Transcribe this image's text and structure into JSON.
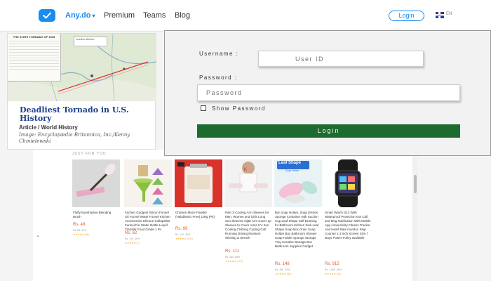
{
  "nav": {
    "brand": "Any.do",
    "links": [
      "Premium",
      "Teams",
      "Blog"
    ],
    "login": "Login",
    "lang": "EN"
  },
  "article": {
    "title": "Deadliest Tornado in U.S. History",
    "subtitle": "Article / World History",
    "credit": "Image: Encyclopædia Britannica, Inc./Kenny Chmielewski",
    "map_table_title": "THE STATE TORNADO OF 1925",
    "map_legend": "counties affected"
  },
  "login": {
    "username_label": "Username :",
    "username_placeholder": "User ID",
    "password_label": "Password :",
    "password_placeholder": "Password",
    "show_password": "Show Password",
    "submit": "Login"
  },
  "products": {
    "section_label": "JUST FOR YOU",
    "items": [
      {
        "name": "Fluffy Eyeshadow Blending Brush",
        "price": "Rs. 49",
        "orig": "Rs. 88 -37%",
        "rating": "★★★★★ (31)"
      },
      {
        "name": "Kitchen Gadgets Silicon Funnel Oil Funnel Water Funnel Kitchen Accessories Silicone Collapsible Funnel For Water Bottle Liquid Transfer Food Grade 1 Pc",
        "price": "Rs. 62",
        "orig": "Rs. 125 -45%",
        "rating": "★★★★★ (7)"
      },
      {
        "name": "Chicken Maze Powder (Halal/MSG Free) 100g (Pk)",
        "price": "Rs. 99",
        "orig": "Rs. 134 -26%",
        "rating": "★★★★★ (102)"
      },
      {
        "name": "Pair of Cooling Arm Sleeves for Men, Women and Girls Long Sun Sleeves Hijab Arm Cover-up Sleeves to Cover Arms UV Sun Cooling Clothing Cycling Golf Running Driving Moisture Wicking & Stretch",
        "price": "Rs. 111",
        "orig": "Rs. 350 -68%",
        "rating": "★★★★★ (172)"
      },
      {
        "name": "Bar Soap Holder, Soap Dishes Sponge Container with Suction Cup Leaf Shape Self Draining for Bathroom Kitchen Sink Leaf Shape Soap Box Drain Soap Holder Box Bathroom Shower Soap Holder Sponge Storage Tray Creative Storage Box Bathroom Supplies Gadget",
        "price": "Rs. 148",
        "orig": "Rs. 259 -43%",
        "rating": "★★★★★ (30)"
      },
      {
        "name": "Smart Watch D13 With Waterproof Protection Get Call and Msg Notification With Mobile App connectivity Fitness Tracker And Heart Rate monitor, Step Counter 1.3 inch Screen Size 7 Days Power Policy available",
        "price": "Rs. 915",
        "orig": "Rs. 1,699 -46%",
        "rating": "★★★★★ (42)"
      }
    ],
    "image_badges": {
      "soap_title": "Leaf Shape",
      "soap_subtitle": "Soap Holder"
    }
  },
  "colors": {
    "accent": "#1a8cf0",
    "login_green": "#1d6b2f",
    "article_title": "#1c3f8a",
    "price": "#e4572e"
  }
}
